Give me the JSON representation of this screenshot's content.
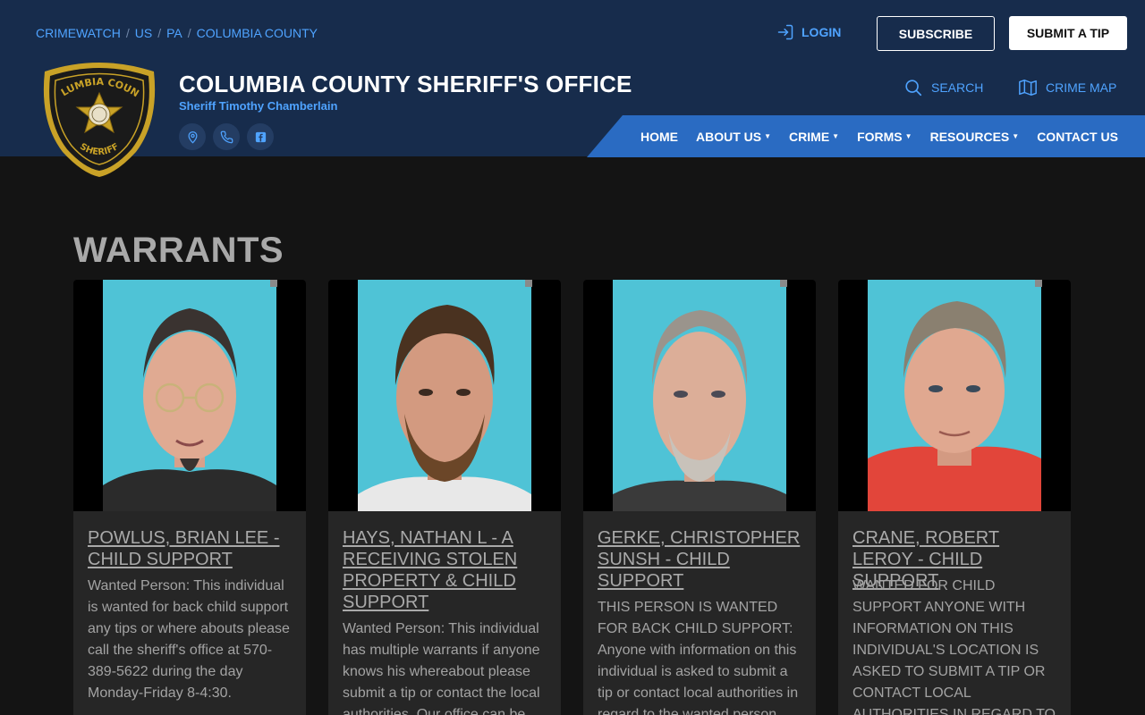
{
  "breadcrumb": {
    "items": [
      "CRIMEWATCH",
      "US",
      "PA",
      "COLUMBIA COUNTY"
    ]
  },
  "header": {
    "login_label": "LOGIN",
    "subscribe_label": "SUBSCRIBE",
    "submit_tip_label": "SUBMIT A TIP",
    "office_title": "COLUMBIA COUNTY SHERIFF'S OFFICE",
    "office_subtitle": "Sheriff Timothy Chamberlain",
    "search_label": "SEARCH",
    "crime_map_label": "CRIME MAP",
    "badge_text_top": "COLUMBIA COUNTY",
    "badge_text_bottom": "SHERIFF"
  },
  "nav": {
    "items": [
      {
        "label": "HOME",
        "dropdown": false
      },
      {
        "label": "ABOUT US",
        "dropdown": true
      },
      {
        "label": "CRIME",
        "dropdown": true
      },
      {
        "label": "FORMS",
        "dropdown": true
      },
      {
        "label": "RESOURCES",
        "dropdown": true
      },
      {
        "label": "CONTACT US",
        "dropdown": false
      }
    ]
  },
  "main": {
    "title": "WARRANTS",
    "cards": [
      {
        "name": "POWLUS, BRIAN LEE - CHILD SUPPORT",
        "description": "Wanted Person: This individual is wanted for back child support any tips or where abouts please call the sheriff's office at 570-389-5622 during the day Monday-Friday 8-4:30.",
        "shirt_color": "#2b2b2b"
      },
      {
        "name": "HAYS, NATHAN L - A RECEIVING STOLEN PROPERTY & CHILD SUPPORT",
        "description": "Wanted Person: This individual has multiple warrants if anyone knows his whereabout please submit a tip or contact the local authorities. Our office can be",
        "shirt_color": "#e8e8e8"
      },
      {
        "name": "GERKE, CHRISTOPHER SUNSH - CHILD SUPPORT",
        "description": "THIS PERSON IS WANTED FOR BACK CHILD SUPPORT: Anyone with information on this individual is asked to submit a tip or contact local authorities in regard to the wanted person",
        "shirt_color": "#3a3a3a"
      },
      {
        "name": "CRANE, ROBERT LEROY - CHILD SUPPORT",
        "description": "WANTED FOR CHILD SUPPORT ANYONE WITH INFORMATION ON THIS INDIVIDUAL'S LOCATION IS ASKED TO SUBMIT A TIP OR CONTACT LOCAL AUTHORITIES IN REGARD TO THE WANTED",
        "shirt_color": "#e2453a"
      }
    ]
  },
  "colors": {
    "header_bg": "#172c4c",
    "nav_bg": "#2a6bc2",
    "accent": "#4fa3ff",
    "photo_bg": "#4fc3d6"
  }
}
